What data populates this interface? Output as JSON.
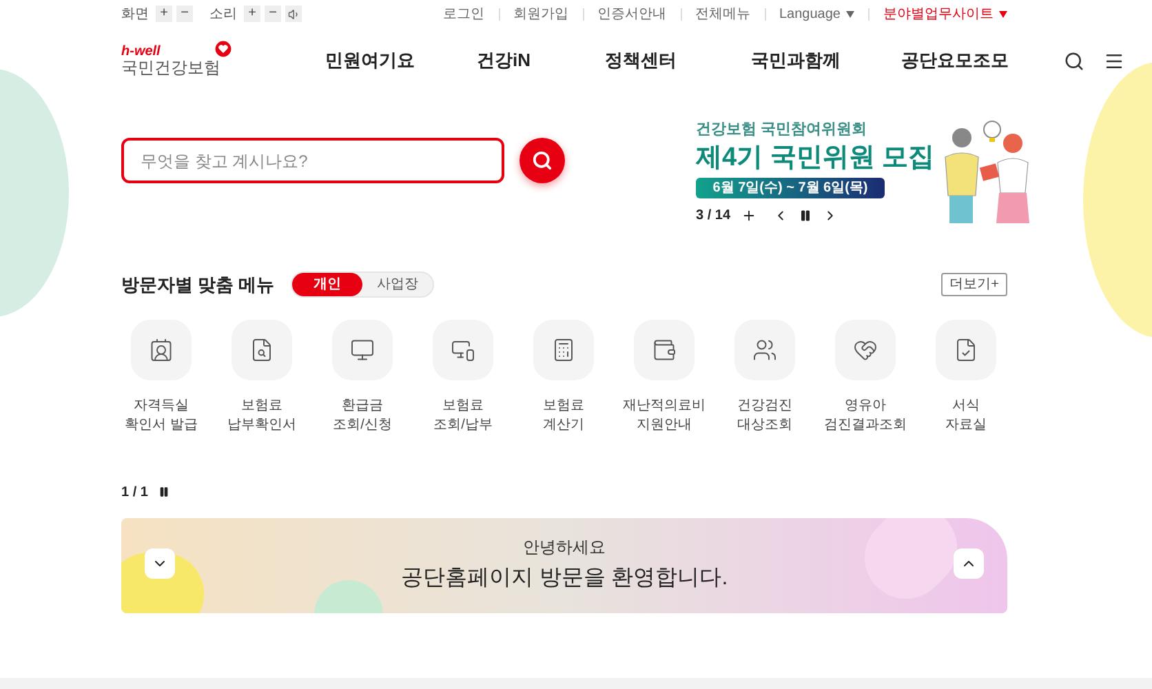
{
  "accessibility": [
    {
      "label": "화면",
      "controls": [
        "+",
        "−"
      ]
    },
    {
      "label": "소리",
      "controls": [
        "+",
        "−"
      ]
    }
  ],
  "utility_links": [
    {
      "label": "로그인",
      "dropdown": false,
      "highlight": false
    },
    {
      "label": "회원가입",
      "dropdown": false,
      "highlight": false
    },
    {
      "label": "인증서안내",
      "dropdown": false,
      "highlight": false
    },
    {
      "label": "전체메뉴",
      "dropdown": false,
      "highlight": false
    },
    {
      "label": "Language",
      "dropdown": true,
      "highlight": false
    },
    {
      "label": "분야별업무사이트",
      "dropdown": true,
      "highlight": true
    }
  ],
  "logo": {
    "tagline": "h-well",
    "name": "국민건강보험"
  },
  "nav": [
    "민원여기요",
    "건강iN",
    "정책센터",
    "국민과함께",
    "공단요모조모"
  ],
  "search": {
    "placeholder": "무엇을 찾고 계시나요?"
  },
  "promo": {
    "subtitle": "건강보험 국민참여위원회",
    "title": "제4기 국민위원 모집",
    "dates": "6월 7일(수) ~ 7월 6일(목)",
    "counter": "3 / 14"
  },
  "quick_menu": {
    "title": "방문자별 맞춤 메뉴",
    "tabs": [
      {
        "label": "개인",
        "selected": true
      },
      {
        "label": "사업장",
        "selected": false
      }
    ],
    "more": "더보기+",
    "items": [
      {
        "lines": [
          "자격득실",
          "확인서 발급"
        ]
      },
      {
        "lines": [
          "보험료",
          "납부확인서"
        ]
      },
      {
        "lines": [
          "환급금",
          "조회/신청"
        ]
      },
      {
        "lines": [
          "보험료",
          "조회/납부"
        ]
      },
      {
        "lines": [
          "보험료",
          "계산기"
        ]
      },
      {
        "lines": [
          "재난적의료비",
          "지원안내"
        ]
      },
      {
        "lines": [
          "건강검진",
          "대상조회"
        ]
      },
      {
        "lines": [
          "영유아",
          "검진결과조회"
        ]
      },
      {
        "lines": [
          "서식",
          "자료실"
        ]
      }
    ]
  },
  "welcome": {
    "counter": "1 / 1",
    "greeting": "안녕하세요",
    "message": "공단홈페이지 방문을 환영합니다."
  }
}
